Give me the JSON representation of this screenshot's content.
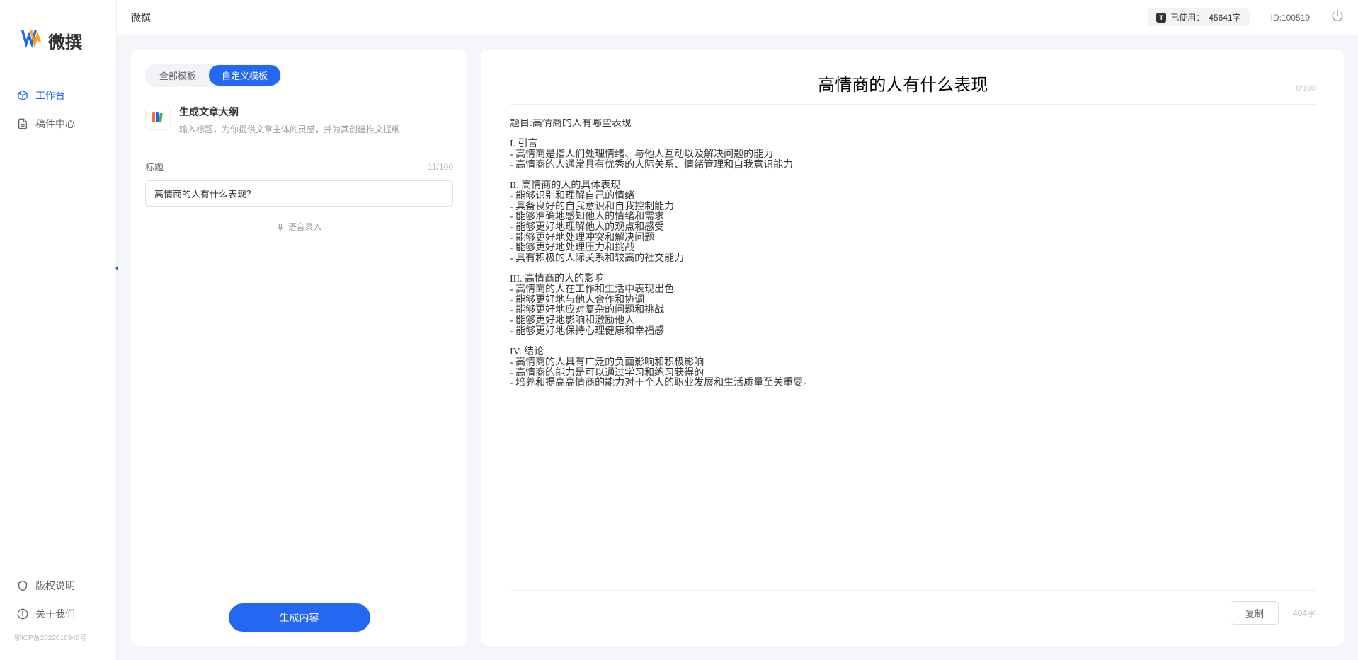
{
  "app": {
    "name": "微撰",
    "logo_text": "微撰"
  },
  "sidebar": {
    "items": [
      {
        "label": "工作台",
        "active": true
      },
      {
        "label": "稿件中心",
        "active": false
      }
    ],
    "footer": [
      {
        "label": "版权说明"
      },
      {
        "label": "关于我们"
      }
    ],
    "icp": "鄂ICP备2022016946号"
  },
  "header": {
    "title": "微撰",
    "usage_label": "已使用：",
    "usage_value": "45641字",
    "user_id_label": "ID:",
    "user_id": "100519"
  },
  "left_panel": {
    "tabs": [
      {
        "label": "全部模板",
        "active": false
      },
      {
        "label": "自定义模板",
        "active": true
      }
    ],
    "template": {
      "title": "生成文章大纲",
      "desc": "输入标题，为你提供文章主体的灵感，并为其创建推文提纲"
    },
    "form": {
      "title_label": "标题",
      "title_count": "11/100",
      "title_value": "高情商的人有什么表现？",
      "voice_label": "语音录入"
    },
    "generate_btn": "生成内容"
  },
  "right_panel": {
    "title": "高情商的人有什么表现",
    "header_count": "0/100",
    "content": "题目:高情商的人有哪些表现\n\nI. 引言\n- 高情商是指人们处理情绪、与他人互动以及解决问题的能力\n- 高情商的人通常具有优秀的人际关系、情绪管理和自我意识能力\n\nII. 高情商的人的具体表现\n- 能够识别和理解自己的情绪\n- 具备良好的自我意识和自我控制能力\n- 能够准确地感知他人的情绪和需求\n- 能够更好地理解他人的观点和感受\n- 能够更好地处理冲突和解决问题\n- 能够更好地处理压力和挑战\n- 具有积极的人际关系和较高的社交能力\n\nIII. 高情商的人的影响\n- 高情商的人在工作和生活中表现出色\n- 能够更好地与他人合作和协调\n- 能够更好地应对复杂的问题和挑战\n- 能够更好地影响和激励他人\n- 能够更好地保持心理健康和幸福感\n\nIV. 结论\n- 高情商的人具有广泛的负面影响和积极影响\n- 高情商的能力是可以通过学习和练习获得的\n- 培养和提高高情商的能力对于个人的职业发展和生活质量至关重要。",
    "copy_btn": "复制",
    "word_count": "404字"
  }
}
